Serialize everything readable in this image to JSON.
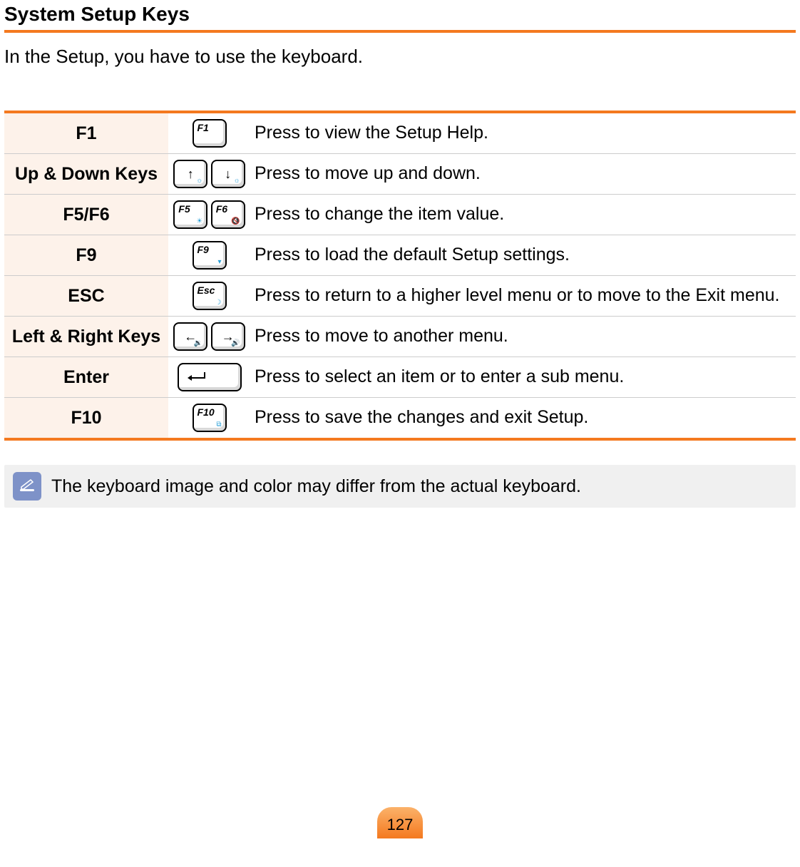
{
  "title": "System Setup Keys",
  "intro": "In the Setup, you have to use the keyboard.",
  "rows": [
    {
      "key": "F1",
      "keycaps": [
        "F1"
      ],
      "desc": "Press to view the Setup Help."
    },
    {
      "key": "Up & Down Keys",
      "keycaps": [
        "↑",
        "↓"
      ],
      "desc": "Press to move up and down."
    },
    {
      "key": "F5/F6",
      "keycaps": [
        "F5",
        "F6"
      ],
      "desc": "Press to change the item value."
    },
    {
      "key": "F9",
      "keycaps": [
        "F9"
      ],
      "desc": "Press to load the default Setup settings."
    },
    {
      "key": "ESC",
      "keycaps": [
        "Esc"
      ],
      "desc": "Press to return to a higher level menu or to move to the Exit menu."
    },
    {
      "key": "Left & Right Keys",
      "keycaps": [
        "←",
        "→"
      ],
      "desc": "Press to move to another menu."
    },
    {
      "key": "Enter",
      "keycaps": [
        "Enter"
      ],
      "desc": "Press to select an item or to enter a sub menu."
    },
    {
      "key": "F10",
      "keycaps": [
        "F10"
      ],
      "desc": "Press to save the changes and exit Setup."
    }
  ],
  "note": "The keyboard image and color may differ from the actual keyboard.",
  "page_number": "127",
  "colors": {
    "accent": "#f4791f",
    "label_bg": "#fdf2ea",
    "note_icon_bg": "#7e92c8"
  }
}
